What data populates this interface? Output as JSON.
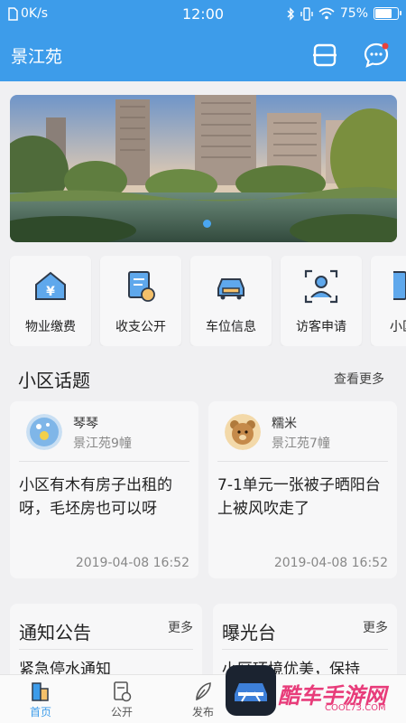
{
  "status_bar": {
    "speed": "0K/s",
    "time": "12:00",
    "battery": "75%",
    "battery_level": 0.75
  },
  "app_bar": {
    "title": "景江苑"
  },
  "banner": {
    "carousel_position": 1
  },
  "quick_actions": [
    {
      "label": "物业缴费",
      "icon": "property-fee-icon"
    },
    {
      "label": "收支公开",
      "icon": "finance-report-icon"
    },
    {
      "label": "车位信息",
      "icon": "parking-car-icon"
    },
    {
      "label": "访客申请",
      "icon": "visitor-scan-icon"
    },
    {
      "label": "小区",
      "icon": "notebook-icon"
    }
  ],
  "topics": {
    "title": "小区话题",
    "more": "查看更多",
    "posts": [
      {
        "user": "琴琴",
        "location": "景江苑9幢",
        "text": "小区有木有房子出租的呀，毛坯房也可以呀",
        "time": "2019-04-08 16:52"
      },
      {
        "user": "糯米",
        "location": "景江苑7幢",
        "text": "7-1单元一张被子晒阳台上被风吹走了",
        "time": "2019-04-08 16:52"
      }
    ]
  },
  "notices": {
    "title": "通知公告",
    "more": "更多",
    "first_item": "紧急停水通知"
  },
  "exposure": {
    "title": "曝光台",
    "more": "更多",
    "first_item": "小区环境优美，保持"
  },
  "tab_bar": [
    {
      "label": "首页",
      "active": true
    },
    {
      "label": "公开",
      "active": false
    },
    {
      "label": "发布",
      "active": false
    }
  ],
  "watermark": {
    "text": "酷车手游网",
    "sub": "COOL73.COM"
  },
  "colors": {
    "primary": "#3d9cea",
    "badge": "#e8423c"
  }
}
